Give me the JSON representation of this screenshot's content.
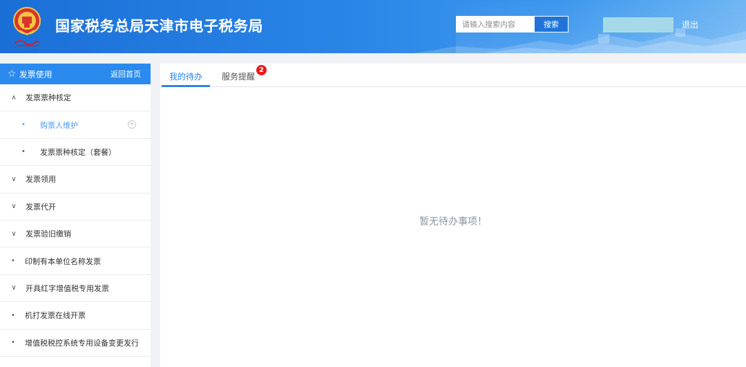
{
  "header": {
    "site_title": "国家税务总局天津市电子税务局",
    "search_placeholder": "请输入搜索内容",
    "search_button": "搜索",
    "logout": "退出",
    "user_box_color": "#a6d9e8"
  },
  "sidebar": {
    "title": "发票使用",
    "home_link": "返回首页",
    "items": [
      {
        "label": "发票票种核定",
        "mark": "∧",
        "level": 0,
        "expanded": true
      },
      {
        "label": "购票人维护",
        "mark": "•",
        "level": 1,
        "active": true,
        "icon": "plus-circle-icon"
      },
      {
        "label": "发票票种核定（套餐）",
        "mark": "•",
        "level": 1
      },
      {
        "label": "发票领用",
        "mark": "∨",
        "level": 0
      },
      {
        "label": "发票代开",
        "mark": "∨",
        "level": 0
      },
      {
        "label": "发票验旧缴销",
        "mark": "∨",
        "level": 0
      },
      {
        "label": "印制有本单位名称发票",
        "mark": "•",
        "level": 0
      },
      {
        "label": "开具红字增值税专用发票",
        "mark": "∨",
        "level": 0
      },
      {
        "label": "机打发票在线开票",
        "mark": "•",
        "level": 0
      },
      {
        "label": "增值税税控系统专用设备变更发行",
        "mark": "•",
        "level": 0
      }
    ]
  },
  "main": {
    "tabs": [
      {
        "label": "我的待办",
        "active": true
      },
      {
        "label": "服务提醒",
        "active": false,
        "badge": "2"
      }
    ],
    "empty_message": "暂无待办事项！"
  },
  "colors": {
    "accent": "#2a84e6",
    "badge": "#e8191c",
    "active_menu": "#4a9bf0"
  }
}
